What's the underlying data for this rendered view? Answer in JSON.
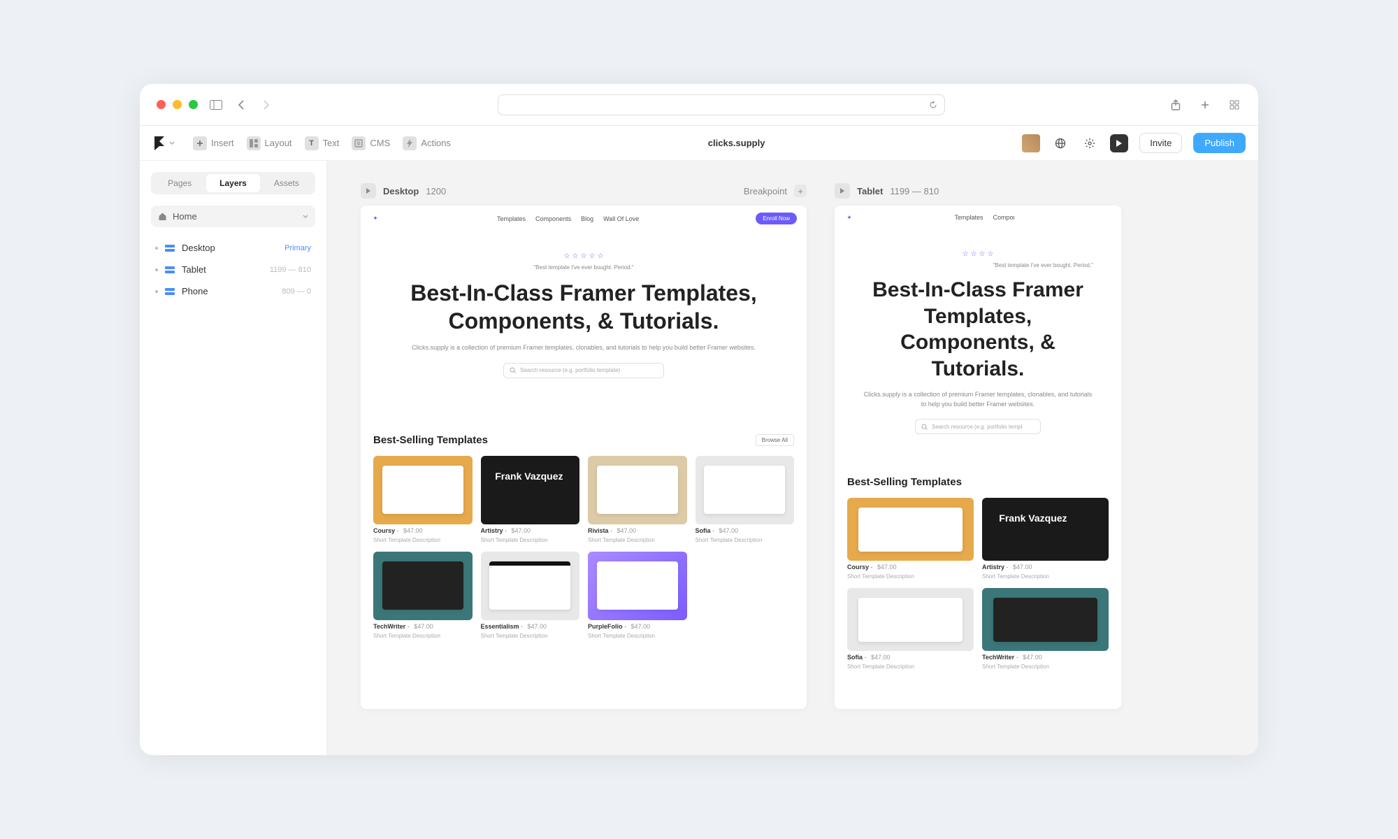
{
  "browser": {
    "url": ""
  },
  "app": {
    "tools": {
      "insert": "Insert",
      "layout": "Layout",
      "text": "Text",
      "cms": "CMS",
      "actions": "Actions"
    },
    "project_title": "clicks.supply",
    "invite": "Invite",
    "publish": "Publish"
  },
  "sidebar": {
    "tabs": {
      "pages": "Pages",
      "layers": "Layers",
      "assets": "Assets"
    },
    "root": "Home",
    "layers": [
      {
        "label": "Desktop",
        "meta": "Primary",
        "primary": true
      },
      {
        "label": "Tablet",
        "meta": "1199 — 810"
      },
      {
        "label": "Phone",
        "meta": "809 — 0"
      }
    ]
  },
  "canvas": {
    "desktop": {
      "name": "Desktop",
      "width": "1200",
      "breakpoint_label": "Breakpoint"
    },
    "tablet": {
      "name": "Tablet",
      "range": "1199 — 810"
    }
  },
  "site": {
    "nav": {
      "items": [
        "Templates",
        "Components",
        "Blog",
        "Wall Of Love"
      ],
      "cta": "Enroll Now"
    },
    "hero": {
      "quote": "\"Best template I've ever bought. Period.\"",
      "title_line1": "Best-In-Class Framer Templates,",
      "title_line2": "Components, & Tutorials.",
      "subtitle": "Clicks.supply is a collection of premium Framer templates, clonables, and tutorials to help you build better Framer websites.",
      "search_placeholder": "Search resource (e.g. portfolio template)"
    },
    "section": {
      "title": "Best-Selling Templates",
      "browse": "Browse All"
    },
    "templates": [
      {
        "name": "Coursy",
        "price": "$47.00",
        "desc": "Short Template Description",
        "theme": "coursy"
      },
      {
        "name": "Artistry",
        "price": "$47.00",
        "desc": "Short Template Description",
        "theme": "artistry",
        "preview_text": "Frank\nVazquez"
      },
      {
        "name": "Rivista",
        "price": "$47.00",
        "desc": "Short Template Description",
        "theme": "rivista"
      },
      {
        "name": "Sofia",
        "price": "$47.00",
        "desc": "Short Template Description",
        "theme": "sofia"
      },
      {
        "name": "TechWriter",
        "price": "$47.00",
        "desc": "Short Template Description",
        "theme": "tech"
      },
      {
        "name": "Essentialism",
        "price": "$47.00",
        "desc": "Short Template Description",
        "theme": "ess"
      },
      {
        "name": "PurpleFolio",
        "price": "$47.00",
        "desc": "Short Template Description",
        "theme": "purple"
      }
    ],
    "tablet_grid": [
      {
        "name": "Coursy",
        "price": "$47.00",
        "desc": "Short Template Description",
        "theme": "coursy"
      },
      {
        "name": "Artistry",
        "price": "$47.00",
        "desc": "Short Template Description",
        "theme": "artistry",
        "preview_text": "Frank\nVazquez"
      },
      {
        "name": "Sofia",
        "price": "$47.00",
        "desc": "Short Template Description",
        "theme": "sofia"
      },
      {
        "name": "TechWriter",
        "price": "$47.00",
        "desc": "Short Template Description",
        "theme": "tech"
      }
    ]
  }
}
